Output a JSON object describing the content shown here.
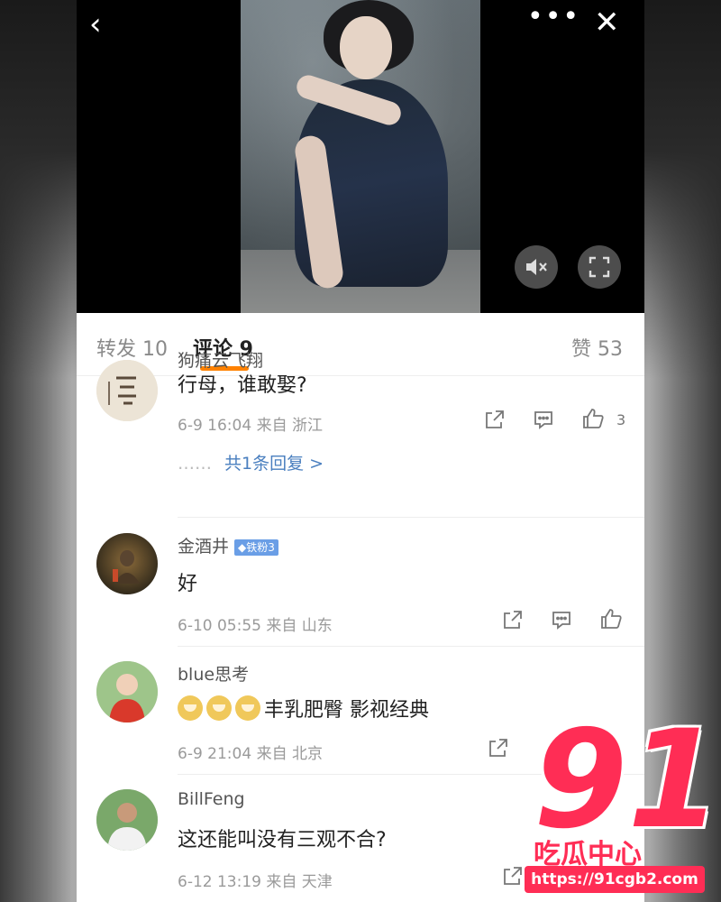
{
  "nav": {
    "back": "‹",
    "more": "•••",
    "close": "✕"
  },
  "player": {
    "mute_icon": "speaker-mute-icon",
    "fullscreen_icon": "fullscreen-icon"
  },
  "tabs": {
    "repost": "转发 10",
    "comment": "评论 9",
    "like": "赞 53",
    "active_color": "#ff8200"
  },
  "comments": [
    {
      "user": "狗痛云飞翔",
      "text": "行母，谁敢娶?",
      "meta": "6-9 16:04  来自 浙江",
      "likes": "3",
      "reply": "共1条回复 >",
      "reply_dots": "……"
    },
    {
      "user": "金酒井",
      "badge": "◆铁粉3",
      "text": "好",
      "meta": "6-10 05:55  来自 山东"
    },
    {
      "user": "blue思考",
      "text": "丰乳肥臀 影视经典",
      "meta": "6-9 21:04  来自 北京"
    },
    {
      "user": "BillFeng",
      "text": "这还能叫没有三观不合?",
      "meta": "6-12 13:19  来自 天津"
    }
  ],
  "watermark": {
    "number": "91",
    "tag": "吃瓜中心",
    "url": "https://91cgb2.com",
    "color": "#ff2d55"
  }
}
